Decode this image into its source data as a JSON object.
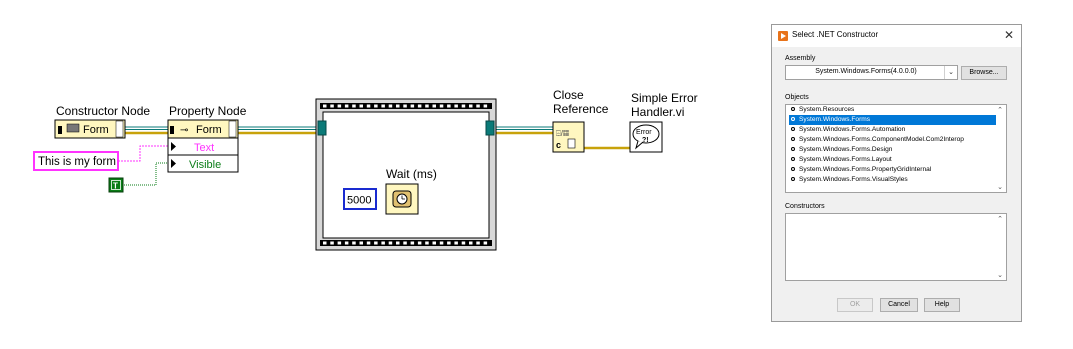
{
  "diagram": {
    "constructor_node": {
      "label": "Constructor Node",
      "class_name": "Form"
    },
    "property_node": {
      "label": "Property Node",
      "class_name": "Form",
      "properties": [
        "Text",
        "Visible"
      ]
    },
    "string_constant": "This is my form",
    "boolean_constant": "T",
    "wait": {
      "label": "Wait (ms)",
      "value": "5000"
    },
    "close_reference": {
      "line1": "Close",
      "line2": "Reference"
    },
    "error_handler": {
      "line1": "Simple Error",
      "line2": "Handler.vi",
      "icon_text": "Error"
    },
    "colors": {
      "refnum_wire": "#0b7a78",
      "error_wire": "#c8a20a",
      "string": "#ff33ff",
      "boolean": "#0a7d17",
      "numeric": "#1a2bd0"
    }
  },
  "dialog": {
    "title": "Select .NET Constructor",
    "assembly_label": "Assembly",
    "assembly_value": "System.Windows.Forms(4.0.0.0)",
    "browse_label": "Browse...",
    "objects_label": "Objects",
    "objects": [
      "System.Resources",
      "System.Windows.Forms",
      "System.Windows.Forms.Automation",
      "System.Windows.Forms.ComponentModel.Com2Interop",
      "System.Windows.Forms.Design",
      "System.Windows.Forms.Layout",
      "System.Windows.Forms.PropertyGridInternal",
      "System.Windows.Forms.VisualStyles"
    ],
    "selected_object_index": 1,
    "constructors_label": "Constructors",
    "ok_label": "OK",
    "cancel_label": "Cancel",
    "help_label": "Help"
  }
}
